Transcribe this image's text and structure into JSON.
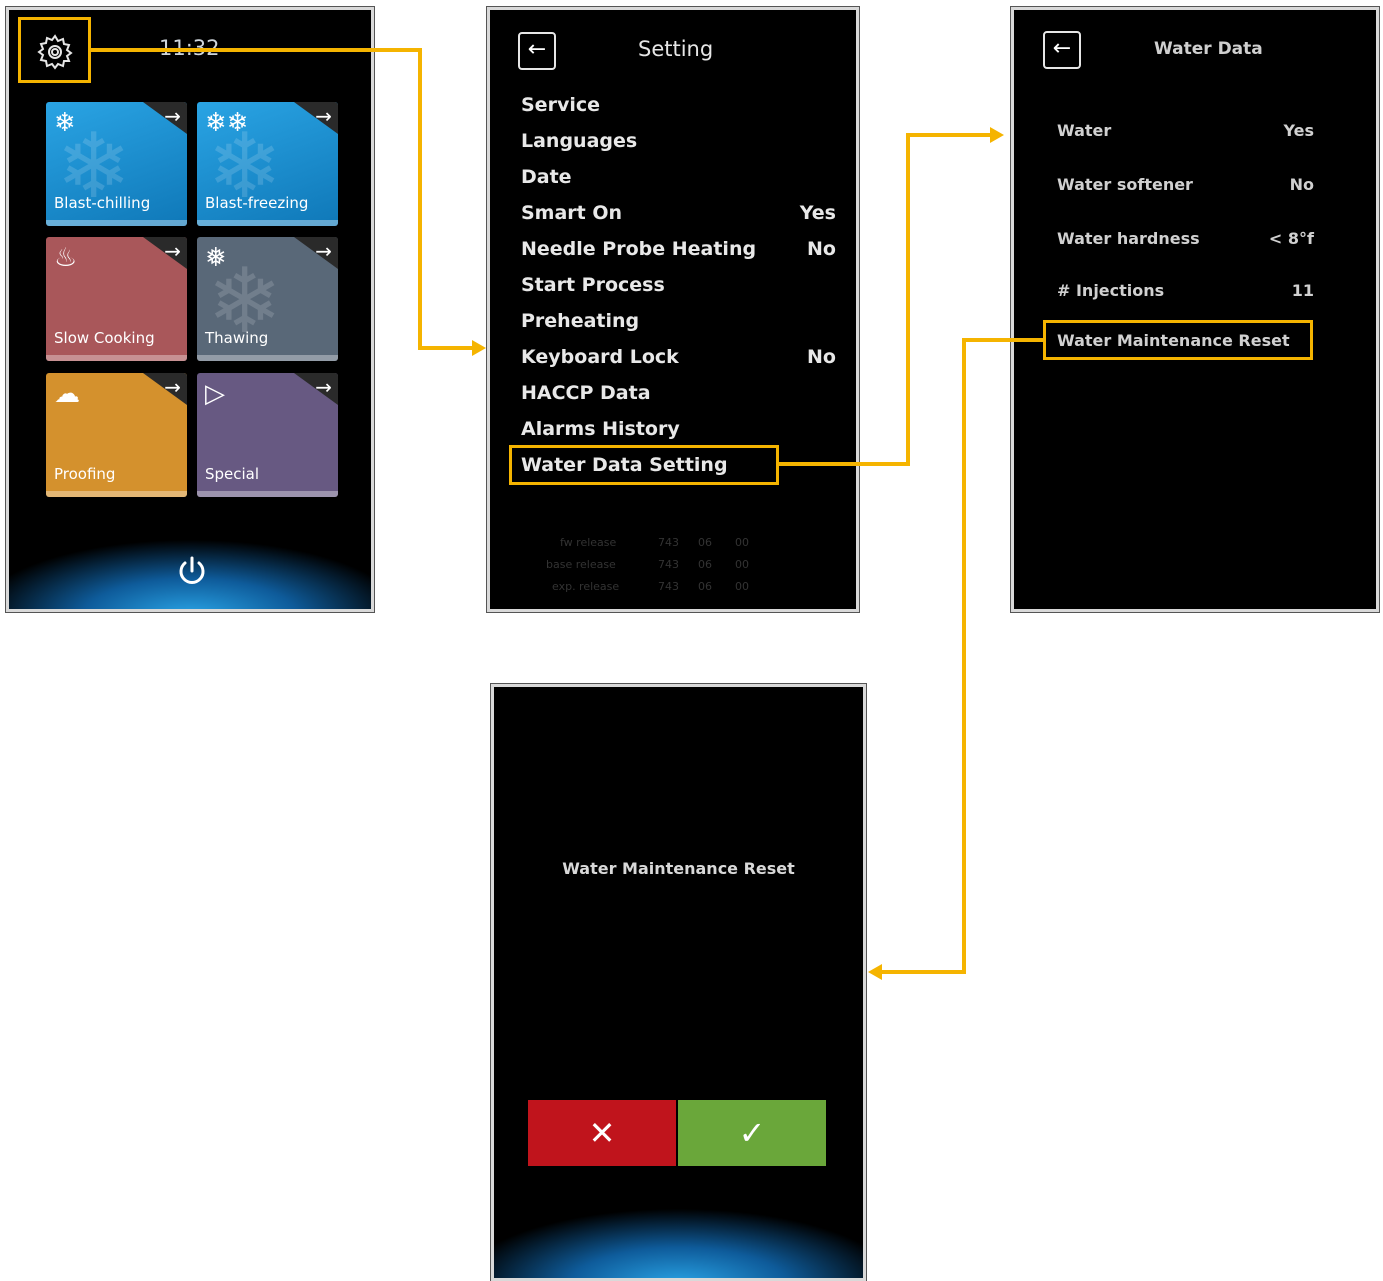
{
  "home": {
    "time": "11:32",
    "tiles": [
      {
        "label": "Blast-chilling",
        "color": "#1b8fd0",
        "icon": "snowflake-icon"
      },
      {
        "label": "Blast-freezing",
        "color": "#1b8fd0",
        "icon": "double-snowflake-icon"
      },
      {
        "label": "Slow Cooking",
        "color": "#b15c5e",
        "icon": "pot-icon"
      },
      {
        "label": "Thawing",
        "color": "#5c6a7a",
        "icon": "drop-snowflake-icon"
      },
      {
        "label": "Proofing",
        "color": "#d9962e",
        "icon": "cupcake-icon"
      },
      {
        "label": "Special",
        "color": "#6a5a86",
        "icon": "special-icon"
      }
    ]
  },
  "setting": {
    "title": "Setting",
    "items": [
      {
        "label": "Service",
        "value": ""
      },
      {
        "label": "Languages",
        "value": ""
      },
      {
        "label": "Date",
        "value": ""
      },
      {
        "label": "Smart On",
        "value": "Yes"
      },
      {
        "label": "Needle Probe Heating",
        "value": "No"
      },
      {
        "label": "Start Process",
        "value": ""
      },
      {
        "label": "Preheating",
        "value": ""
      },
      {
        "label": "Keyboard Lock",
        "value": "No"
      },
      {
        "label": "HACCP Data",
        "value": ""
      },
      {
        "label": "Alarms History",
        "value": ""
      },
      {
        "label": "Water Data Setting",
        "value": ""
      }
    ],
    "release": [
      {
        "label": "fw release",
        "v1": "743",
        "v2": "06",
        "v3": "00"
      },
      {
        "label": "base release",
        "v1": "743",
        "v2": "06",
        "v3": "00"
      },
      {
        "label": "exp. release",
        "v1": "743",
        "v2": "06",
        "v3": "00"
      }
    ]
  },
  "water_data": {
    "title": "Water Data",
    "items": [
      {
        "label": "Water",
        "value": "Yes"
      },
      {
        "label": "Water softener",
        "value": "No"
      },
      {
        "label": "Water hardness",
        "value": "< 8°f"
      },
      {
        "label": "# Injections",
        "value": "11"
      },
      {
        "label": "Water Maintenance Reset",
        "value": ""
      }
    ]
  },
  "confirm": {
    "title": "Water Maintenance Reset",
    "cancel": "✕",
    "ok": "✓",
    "cancel_color": "#c0141c",
    "ok_color": "#6aa73a"
  },
  "accent": "#f5b400"
}
